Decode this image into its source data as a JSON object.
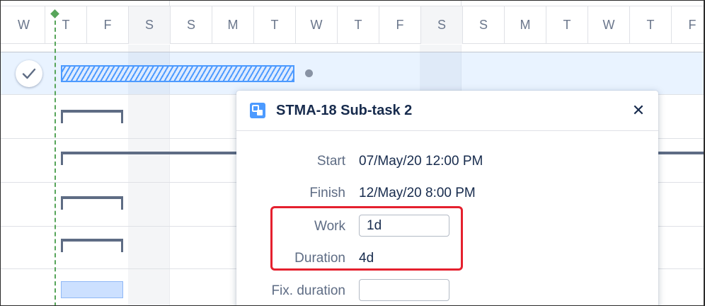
{
  "timeline": {
    "days": [
      "W",
      "T",
      "F",
      "S",
      "S",
      "M",
      "T",
      "W",
      "T",
      "F",
      "S",
      "S",
      "M",
      "T",
      "W",
      "T",
      "F"
    ]
  },
  "popup": {
    "title": "STMA-18 Sub-task 2",
    "icon": "subtask-icon",
    "close_icon": "close-icon",
    "close_glyph": "✕",
    "fields": {
      "start_label": "Start",
      "start_value": "07/May/20 12:00 PM",
      "finish_label": "Finish",
      "finish_value": "12/May/20 8:00 PM",
      "work_label": "Work",
      "work_value": "1d",
      "duration_label": "Duration",
      "duration_value": "4d",
      "fix_duration_label": "Fix. duration",
      "fix_duration_value": ""
    }
  },
  "colors": {
    "accent": "#4c9aff",
    "today_line": "#57a55a",
    "highlight": "#e5202e",
    "bracket": "#5e6c84"
  }
}
